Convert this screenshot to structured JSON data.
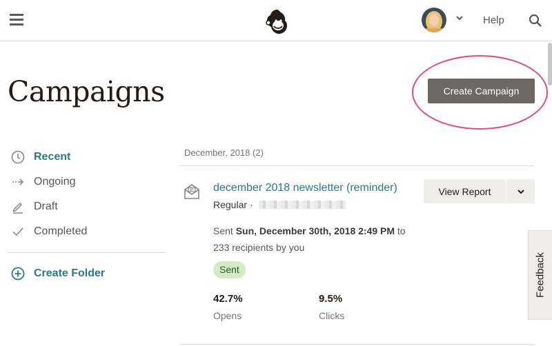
{
  "header": {
    "menu_icon": "hamburger-icon",
    "logo_icon": "mailchimp-freddie-logo",
    "help_label": "Help",
    "search_icon": "search-icon"
  },
  "page": {
    "title": "Campaigns",
    "create_button_label": "Create Campaign",
    "highlight_color": "#e5487a"
  },
  "sidebar": {
    "items": [
      {
        "label": "Recent",
        "icon": "clock-icon",
        "active": true
      },
      {
        "label": "Ongoing",
        "icon": "dashed-arrow-icon",
        "active": false
      },
      {
        "label": "Draft",
        "icon": "pencil-icon",
        "active": false
      },
      {
        "label": "Completed",
        "icon": "checkmark-icon",
        "active": false
      }
    ],
    "create_folder_label": "Create Folder"
  },
  "list": {
    "month_header": "December, 2018 (2)",
    "campaign": {
      "title": "december 2018 newsletter (reminder)",
      "type": "Regular",
      "sent_prefix": "Sent",
      "sent_date": "Sun, December 30th, 2018 2:49 PM",
      "sent_to": "to",
      "sent_suffix": "233 recipients by you",
      "status": "Sent",
      "stats": [
        {
          "value": "42.7%",
          "label": "Opens"
        },
        {
          "value": "9.5%",
          "label": "Clicks"
        }
      ],
      "report_button_label": "View Report"
    }
  },
  "feedback_label": "Feedback",
  "colors": {
    "accent_teal": "#2a7c84",
    "primary_button": "#6e6863",
    "status_badge": "#d5ebc8"
  }
}
